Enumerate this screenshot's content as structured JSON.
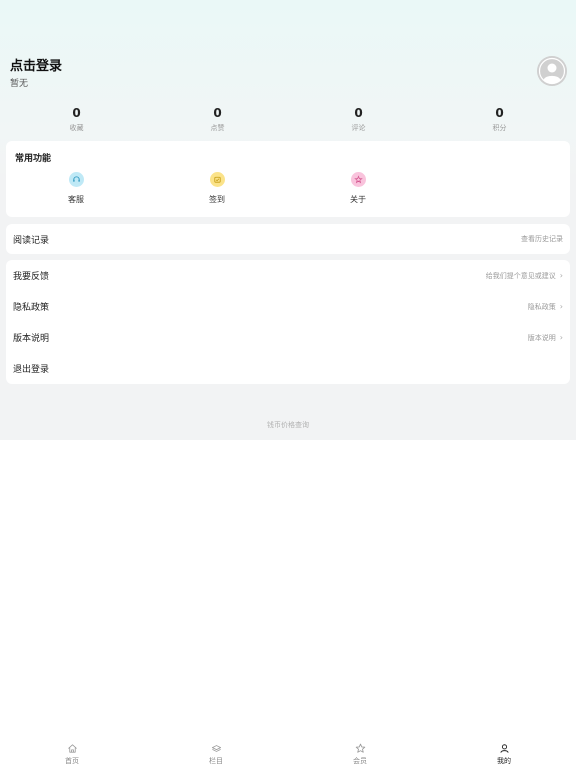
{
  "profile": {
    "login_label": "点击登录",
    "subtitle": "暂无"
  },
  "avatar": {
    "icon": "avatar-icon"
  },
  "stats": [
    {
      "value": "0",
      "label": "收藏"
    },
    {
      "value": "0",
      "label": "点赞"
    },
    {
      "value": "0",
      "label": "评论"
    },
    {
      "value": "0",
      "label": "积分"
    }
  ],
  "functions": {
    "title": "常用功能",
    "items": [
      {
        "label": "客服",
        "icon": "customer-service-icon",
        "color": "#bfe9f6"
      },
      {
        "label": "签到",
        "icon": "check-in-icon",
        "color": "#fbe38a"
      },
      {
        "label": "关于",
        "icon": "about-icon",
        "color": "#f9c3dc"
      }
    ]
  },
  "history": {
    "title": "阅读记录",
    "action": "查看历史记录"
  },
  "menu": [
    {
      "title": "我要反馈",
      "hint": "给我们提个意见或建议",
      "chevron": true
    },
    {
      "title": "隐私政策",
      "hint": "隐私政策",
      "chevron": true
    },
    {
      "title": "版本说明",
      "hint": "版本说明",
      "chevron": true
    },
    {
      "title": "退出登录",
      "hint": "",
      "chevron": false
    }
  ],
  "footer": {
    "text": "钱币价格查询"
  },
  "tabbar": [
    {
      "label": "首页",
      "icon": "home-icon",
      "active": false
    },
    {
      "label": "栏目",
      "icon": "category-icon",
      "active": false
    },
    {
      "label": "会员",
      "icon": "star-icon",
      "active": false
    },
    {
      "label": "我的",
      "icon": "user-icon",
      "active": true
    }
  ],
  "colors": {
    "accent": "#222222",
    "background": "#f2f3f4",
    "muted": "#999999"
  }
}
